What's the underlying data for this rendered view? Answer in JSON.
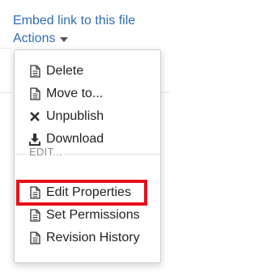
{
  "page": {
    "embed_link": "Embed link to this file",
    "actions_label": "Actions"
  },
  "menu": {
    "items": [
      {
        "label": "Delete",
        "icon": "document-icon"
      },
      {
        "label": "Move to...",
        "icon": "document-icon"
      },
      {
        "label": "Unpublish",
        "icon": "x-icon"
      },
      {
        "label": "Download",
        "icon": "download-icon"
      }
    ],
    "edit_section": {
      "header": "EDIT...",
      "items": [
        {
          "label": "Edit Properties",
          "icon": "document-icon",
          "highlighted": true
        },
        {
          "label": "Set Permissions",
          "icon": "document-icon"
        },
        {
          "label": "Revision History",
          "icon": "document-icon"
        }
      ]
    }
  },
  "colors": {
    "link": "#2f6db3",
    "highlight_border": "#e8101a"
  }
}
